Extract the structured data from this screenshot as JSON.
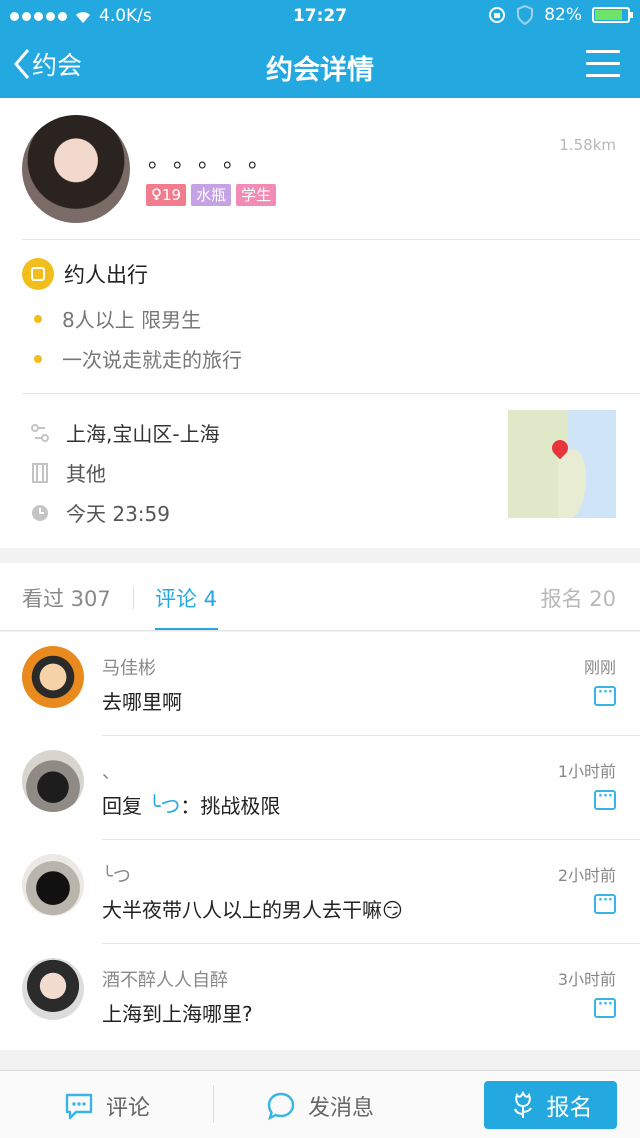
{
  "status_bar": {
    "network": "4.0K/s",
    "time": "17:27",
    "battery": "82%"
  },
  "nav": {
    "back_label": "约会",
    "title": "约会详情"
  },
  "profile": {
    "nickname": "。。。。。",
    "distance": "1.58km",
    "tags": {
      "age": "19",
      "star_sign": "水瓶",
      "occupation": "学生"
    }
  },
  "date_info": {
    "theme": "约人出行",
    "conditions": [
      "8人以上 限男生",
      "一次说走就走的旅行"
    ],
    "location": "上海,宝山区-上海",
    "payment": "其他",
    "time": "今天 23:59"
  },
  "tabs": {
    "viewed": "看过 307",
    "comments": "评论 4",
    "signups": "报名 20"
  },
  "comments": [
    {
      "name": "马佳彬",
      "time": "刚刚",
      "text": "去哪里啊"
    },
    {
      "name": "、",
      "time": "1小时前",
      "text_prefix": "回复",
      "reply_to": "╰つ",
      "text": "：挑战极限"
    },
    {
      "name": "╰つ",
      "time": "2小时前",
      "text": "大半夜带八人以上的男人去干嘛😏"
    },
    {
      "name": "酒不醉人人自醉",
      "time": "3小时前",
      "text": "上海到上海哪里?"
    }
  ],
  "bottom_bar": {
    "comment_label": "评论",
    "message_label": "发消息",
    "signup_label": "报名"
  },
  "colors": {
    "brand": "#24a8e0",
    "accent_yellow": "#f1be1e"
  }
}
